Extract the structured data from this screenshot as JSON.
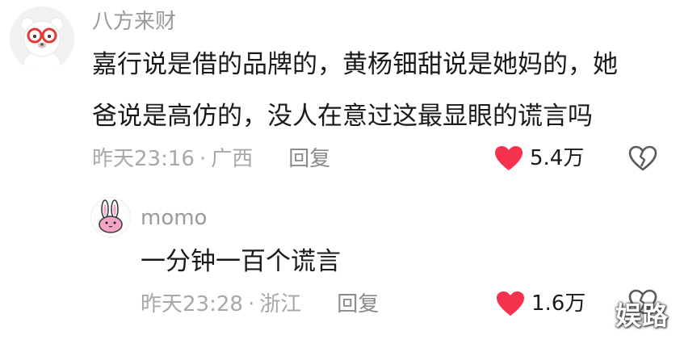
{
  "comment": {
    "username": "八方来财",
    "text_line1": "嘉行说是借的品牌的，黄杨钿甜说是她妈的，她",
    "text_line2": "爸说是高仿的，没人在意过这最显眼的谎言吗",
    "time": "昨天23:16",
    "separator": "·",
    "location": "广西",
    "reply_label": "回复",
    "like_count": "5.4万",
    "avatar_icon": "red-glasses-bear-avatar",
    "like_color": "#f6324f"
  },
  "reply": {
    "username": "momo",
    "text": "一分钟一百个谎言",
    "time": "昨天23:28",
    "separator": "·",
    "location": "浙江",
    "reply_label": "回复",
    "like_count": "1.6万",
    "avatar_icon": "pink-rabbit-avatar",
    "like_color": "#f6324f"
  },
  "watermark": "娱路",
  "icons": {
    "like": "heart-icon",
    "dislike": "broken-heart-icon"
  }
}
